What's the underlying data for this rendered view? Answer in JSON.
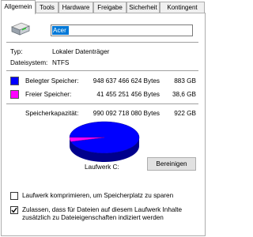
{
  "tabs": [
    {
      "label": "Allgemein",
      "active": true
    },
    {
      "label": "Tools",
      "active": false
    },
    {
      "label": "Hardware",
      "active": false
    },
    {
      "label": "Freigabe",
      "active": false
    },
    {
      "label": "Sicherheit",
      "active": false
    },
    {
      "label": "Kontingent",
      "active": false
    }
  ],
  "drive": {
    "icon": "hard-drive-icon",
    "name": "Acer"
  },
  "info": {
    "type_label": "Typ:",
    "type_value": "Lokaler Datenträger",
    "fs_label": "Dateisystem:",
    "fs_value": "NTFS"
  },
  "used": {
    "label": "Belegter Speicher:",
    "bytes": "948 637 466 624 Bytes",
    "size": "883 GB",
    "color": "#0000ff"
  },
  "free": {
    "label": "Freier Speicher:",
    "bytes": "41 455 251 456 Bytes",
    "size": "38,6 GB",
    "color": "#ff00ff"
  },
  "capacity": {
    "label": "Speicherkapazität:",
    "bytes": "990 092 718 080 Bytes",
    "size": "922 GB"
  },
  "chart_data": {
    "type": "pie",
    "categories": [
      "Belegter Speicher",
      "Freier Speicher"
    ],
    "values": [
      883,
      38.6
    ],
    "colors": [
      "#0000ff",
      "#ff00ff"
    ],
    "title": "Laufwerk C:"
  },
  "cleanup_button": "Bereinigen",
  "options": {
    "compress": {
      "label": "Laufwerk komprimieren, um Speicherplatz zu sparen",
      "checked": false
    },
    "index": {
      "label_line1": "Zulassen, dass für Dateien auf diesem Laufwerk Inhalte",
      "label_line2": "zusätzlich zu Dateieigenschaften indiziert werden",
      "checked": true
    }
  }
}
